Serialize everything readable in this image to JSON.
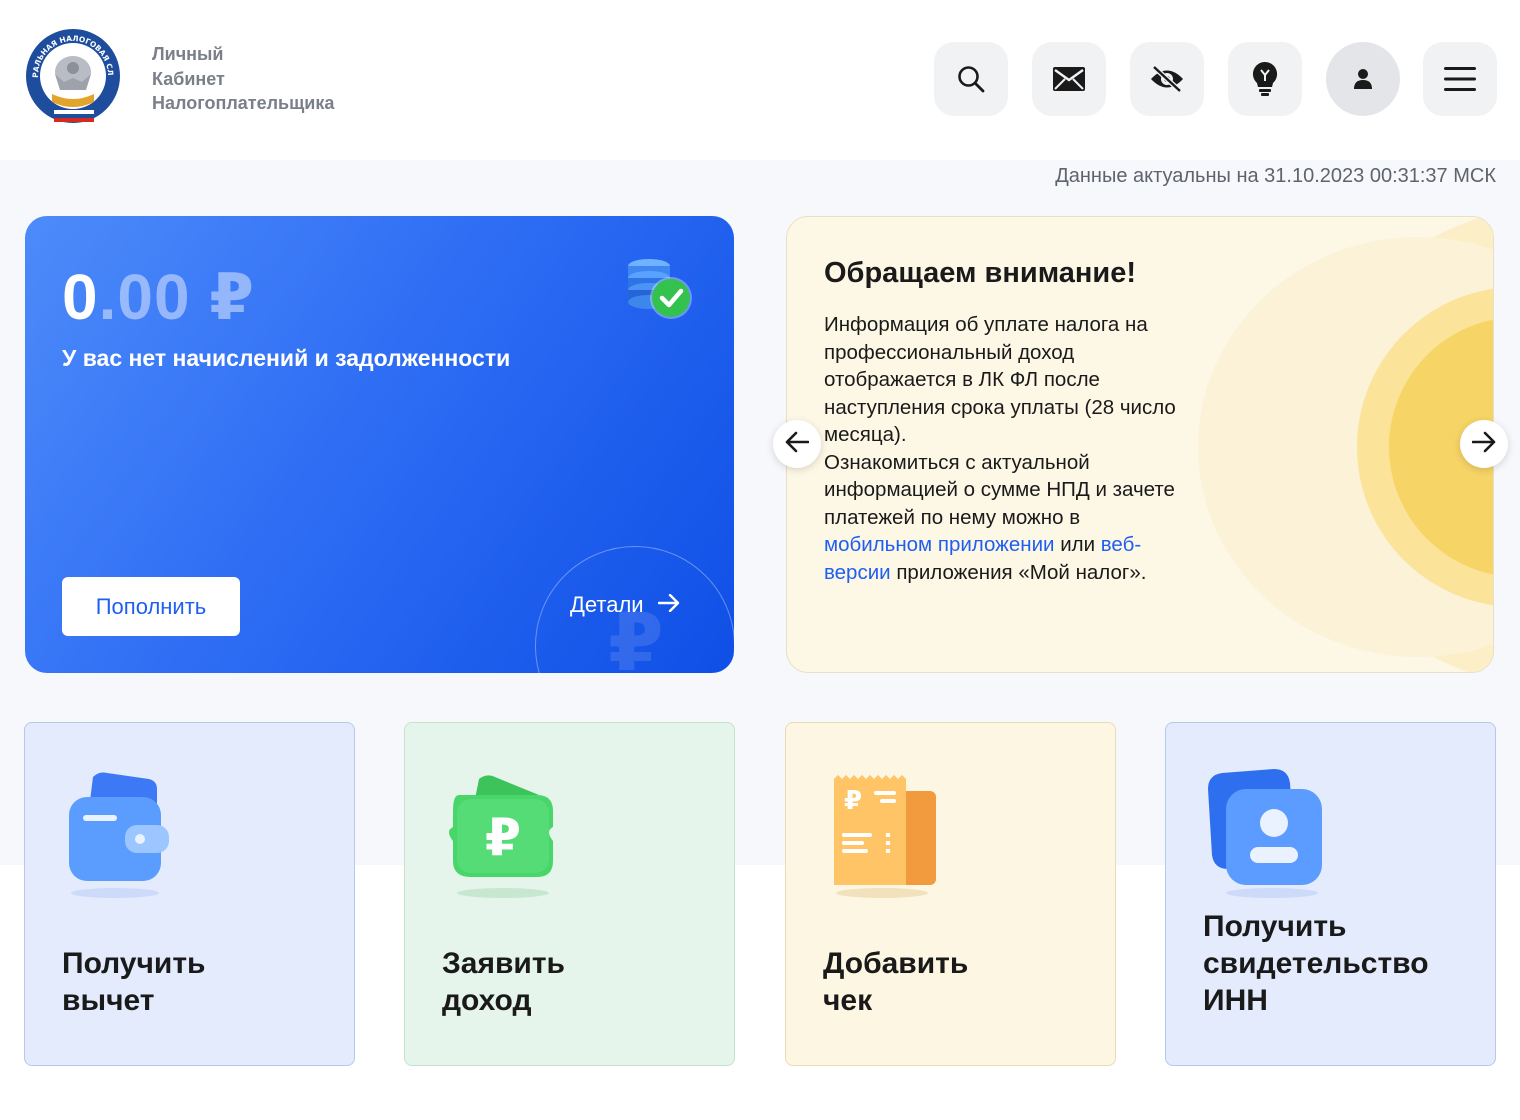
{
  "header": {
    "logo_text": "ФЕДЕРАЛЬНАЯ НАЛОГОВАЯ СЛУЖБА",
    "brand_lines": [
      "Личный",
      "Кабинет",
      "Налогоплательщика"
    ],
    "icons": [
      "search-icon",
      "mail-icon",
      "eye-off-icon",
      "lightbulb-icon",
      "user-icon",
      "menu-icon"
    ]
  },
  "timestamp": "Данные актуальны на 31.10.2023 00:31:37 МСК",
  "balance": {
    "amount_int": "0",
    "amount_frac": ".00 ₽",
    "note": "У вас нет начислений и задолженности",
    "topup_label": "Пополнить",
    "details_label": "Детали",
    "watermark": "₽"
  },
  "notice": {
    "title": "Обращаем внимание!",
    "text_part1": "Информация об уплате налога на профессиональный доход отображается в ЛК ФЛ после наступления срока уплаты (28 число месяца).",
    "text_part2": "Ознакомиться с актуальной информацией о сумме НПД и зачете платежей по нему можно в ",
    "link1": "мобильном приложении",
    "text_or": " или ",
    "link2": "веб-версии",
    "text_end": " приложения «Мой налог»."
  },
  "tiles": [
    {
      "label": "Получить\nвычет",
      "icon": "wallet-icon"
    },
    {
      "label": "Заявить\nдоход",
      "icon": "ruble-wallet-icon"
    },
    {
      "label": "Добавить\nчек",
      "icon": "receipt-icon"
    },
    {
      "label": "Получить\nсвидетельство\nИНН",
      "icon": "id-card-icon"
    }
  ],
  "colors": {
    "accent": "#1f5ff0",
    "card_blue": "#2f6ef4",
    "notice_bg": "#fdf7e6"
  }
}
